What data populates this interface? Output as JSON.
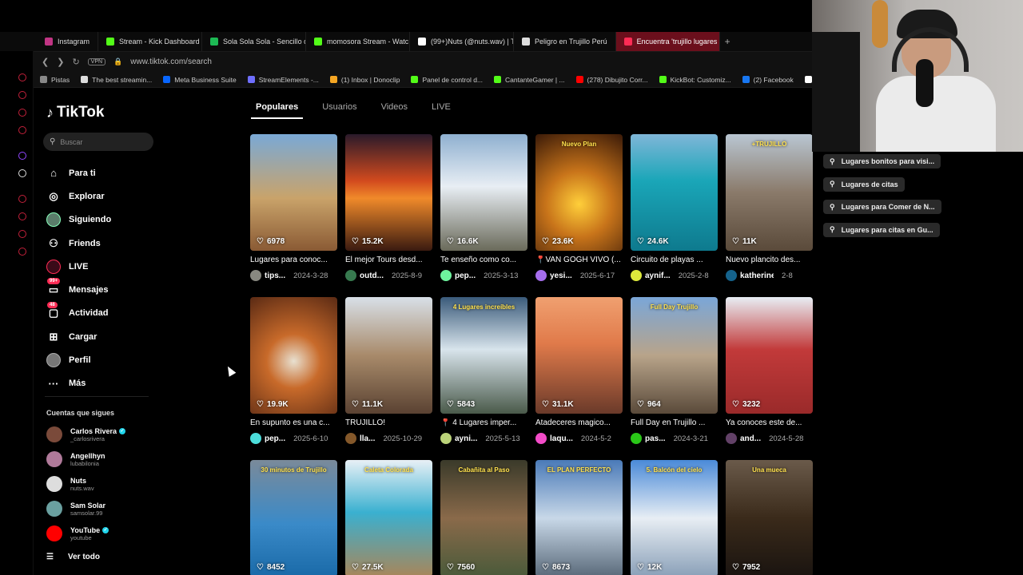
{
  "browser": {
    "tabs": [
      {
        "label": "Instagram",
        "color": "#c13584",
        "active": false
      },
      {
        "label": "Stream - Kick Dashboard",
        "color": "#53fc18",
        "active": false
      },
      {
        "label": "Sola Sola Sola - Sencillo d",
        "color": "#1db954",
        "active": false
      },
      {
        "label": "momosora Stream - Watc",
        "color": "#53fc18",
        "active": false
      },
      {
        "label": "(99+)Nuts (@nuts.wav) | T",
        "color": "#ffffff",
        "active": false
      },
      {
        "label": "Peligro en Trujillo Perú",
        "color": "#dddddd",
        "active": false
      },
      {
        "label": "Encuentra 'trujillo lugares ...",
        "color": "#fe2c55",
        "active": true
      }
    ],
    "new_tab": "+",
    "vpn_label": "VPN",
    "url": "www.tiktok.com/search",
    "bookmarks": [
      {
        "label": "Pistas",
        "color": "#888888"
      },
      {
        "label": "The best streamin...",
        "color": "#dddddd"
      },
      {
        "label": "Meta Business Suite",
        "color": "#0866ff"
      },
      {
        "label": "StreamElements -...",
        "color": "#6f6fff"
      },
      {
        "label": "(1) Inbox | Donoclip",
        "color": "#f5a623"
      },
      {
        "label": "Panel de control d...",
        "color": "#53fc18"
      },
      {
        "label": "CantanteGamer | ...",
        "color": "#53fc18"
      },
      {
        "label": "(278) Dibujito Corr...",
        "color": "#ff0000"
      },
      {
        "label": "KickBot: Customiz...",
        "color": "#53fc18"
      },
      {
        "label": "(2) Facebook",
        "color": "#1877f2"
      },
      {
        "label": "Fre",
        "color": "#ffffff"
      }
    ]
  },
  "sidebar": {
    "logo": "TikTok",
    "search_placeholder": "Buscar",
    "nav": [
      {
        "label": "Para ti",
        "icon": "home-icon",
        "glyph": "⌂"
      },
      {
        "label": "Explorar",
        "icon": "compass-icon",
        "glyph": "◎"
      },
      {
        "label": "Siguiendo",
        "icon": "avatar-icon",
        "glyph": ""
      },
      {
        "label": "Friends",
        "icon": "friends-icon",
        "glyph": "⚇"
      },
      {
        "label": "LIVE",
        "icon": "live-icon",
        "glyph": ""
      },
      {
        "label": "Mensajes",
        "icon": "message-icon",
        "glyph": "▭",
        "badge": "99+"
      },
      {
        "label": "Actividad",
        "icon": "activity-icon",
        "glyph": "▢",
        "badge": "48"
      },
      {
        "label": "Cargar",
        "icon": "upload-icon",
        "glyph": "⊞"
      },
      {
        "label": "Perfil",
        "icon": "profile-icon",
        "glyph": ""
      },
      {
        "label": "Más",
        "icon": "more-icon",
        "glyph": "···"
      }
    ],
    "following_title": "Cuentas que sigues",
    "following": [
      {
        "name": "Carlos Rivera",
        "handle": "_carlosrivera",
        "verified": true,
        "color": "#7a4a3a"
      },
      {
        "name": "Angellhyn",
        "handle": "lubabilonia",
        "verified": false,
        "color": "#b07a9a"
      },
      {
        "name": "Nuts",
        "handle": "nuts.wav",
        "verified": false,
        "color": "#dddddd"
      },
      {
        "name": "Sam Solar",
        "handle": "samsolar.99",
        "verified": false,
        "color": "#6aa0a0"
      },
      {
        "name": "YouTube",
        "handle": "youtube",
        "verified": true,
        "color": "#ff0000"
      }
    ],
    "see_all": "Ver todo"
  },
  "search_tabs": [
    {
      "label": "Populares",
      "active": true
    },
    {
      "label": "Usuarios",
      "active": false
    },
    {
      "label": "Videos",
      "active": false
    },
    {
      "label": "LIVE",
      "active": false
    }
  ],
  "videos": [
    {
      "likes": "6978",
      "title": "Lugares para conoc...",
      "user": "tips...",
      "date": "2024-3-28",
      "bg": "linear-gradient(180deg,#7aa9d6 0%,#c9a36a 55%,#8a5a34 100%)",
      "overlay": ""
    },
    {
      "likes": "15.2K",
      "title": "El mejor Tours desd...",
      "user": "outd...",
      "date": "2025-8-9",
      "bg": "linear-gradient(180deg,#2a1a2a 0%,#d24a1e 40%,#f08a2a 55%,#3a1a10 100%)",
      "overlay": ""
    },
    {
      "likes": "16.6K",
      "title": "Te enseño como co...",
      "user": "pep...",
      "date": "2025-3-13",
      "bg": "linear-gradient(180deg,#8fb0d0 0%,#e8eef4 45%,#6a6a5a 100%)",
      "overlay": ""
    },
    {
      "likes": "23.6K",
      "title": "📍VAN GOGH VIVO (...",
      "user": "yesi...",
      "date": "2025-6-17",
      "bg": "radial-gradient(circle at 50% 60%,#ffcf3a 0%,#c8741a 40%,#3a1a08 100%)",
      "overlay": "Nuevo Plan"
    },
    {
      "likes": "24.6K",
      "title": "Circuito de playas ...",
      "user": "aynif...",
      "date": "2025-2-8",
      "bg": "linear-gradient(180deg,#7fb6d8 0%,#1aa6b8 40%,#0e7a8e 100%)",
      "overlay": ""
    },
    {
      "likes": "11K",
      "title": "Nuevo plancito des...",
      "user": "katherine....",
      "date": "2-8",
      "bg": "linear-gradient(180deg,#b9c6d2 0%,#8a7a6a 50%,#5a4a3a 100%)",
      "overlay": "+TRUJILLO"
    },
    {
      "likes": "19.9K",
      "title": "En supunto es una c...",
      "user": "pep...",
      "date": "2025-6-10",
      "bg": "radial-gradient(circle at 50% 55%,#e8e0d0 0%,#c86a2a 35%,#5a2a14 100%)",
      "overlay": ""
    },
    {
      "likes": "11.1K",
      "title": "TRUJILLO!",
      "user": "lla...",
      "date": "2025-10-29",
      "bg": "linear-gradient(180deg,#d8e0e8 0%,#a88a6a 50%,#5a4232 100%)",
      "overlay": ""
    },
    {
      "likes": "5843",
      "title": "📍 4 Lugares imper...",
      "user": "ayni...",
      "date": "2025-5-13",
      "bg": "linear-gradient(180deg,#3a5a7a 0%,#d8e4ec 45%,#4a5a4a 100%)",
      "overlay": "4 Lugares increíbles"
    },
    {
      "likes": "31.1K",
      "title": "Atadeceres magico...",
      "user": "laqu...",
      "date": "2024-5-2",
      "bg": "linear-gradient(180deg,#f0a070 0%,#e07a4a 40%,#6a3a2a 100%)",
      "overlay": ""
    },
    {
      "likes": "964",
      "title": "Full Day en Trujillo ...",
      "user": "pas...",
      "date": "2024-3-21",
      "bg": "linear-gradient(180deg,#7aa6d8 0%,#b8a48a 50%,#5a4a3a 100%)",
      "overlay": "Full Day Trujillo"
    },
    {
      "likes": "3232",
      "title": "Ya conoces este de...",
      "user": "and...",
      "date": "2024-5-28",
      "bg": "linear-gradient(180deg,#e8eef4 0%,#c23a3a 45%,#9a2a2a 100%)",
      "overlay": ""
    },
    {
      "likes": "8452",
      "title": "",
      "user": "",
      "date": "",
      "bg": "linear-gradient(180deg,#7a8a9a 0%,#3a8ac8 55%,#1a6aa8 100%)",
      "overlay": "30 minutos de Trujillo"
    },
    {
      "likes": "27.5K",
      "title": "",
      "user": "",
      "date": "",
      "bg": "linear-gradient(180deg,#e8f0f6 0%,#3ab0d0 45%,#a8865a 100%)",
      "overlay": "Caleta Colorada"
    },
    {
      "likes": "7560",
      "title": "",
      "user": "",
      "date": "",
      "bg": "linear-gradient(180deg,#3a3a2a 0%,#8a6a4a 50%,#4a5a3a 100%)",
      "overlay": "Cabañita al Paso"
    },
    {
      "likes": "8673",
      "title": "",
      "user": "",
      "date": "",
      "bg": "linear-gradient(180deg,#4a7ab8 0%,#c8d8e8 50%,#5a6a7a 100%)",
      "overlay": "EL PLAN PERFECTO"
    },
    {
      "likes": "12K",
      "title": "",
      "user": "",
      "date": "",
      "bg": "linear-gradient(180deg,#4a8ad8 0%,#e8eef4 50%,#8aa0b8 100%)",
      "overlay": "5. Balcón del cielo"
    },
    {
      "likes": "7952",
      "title": "",
      "user": "",
      "date": "",
      "bg": "linear-gradient(180deg,#6a5a4a 0%,#3a2a1a 50%,#1a1410 100%)",
      "overlay": "Una mueca"
    }
  ],
  "suggestions": [
    "Lugares bonitos para visi...",
    "Lugares de citas",
    "Lugares para Comer de N...",
    "Lugares para citas en Gu..."
  ]
}
